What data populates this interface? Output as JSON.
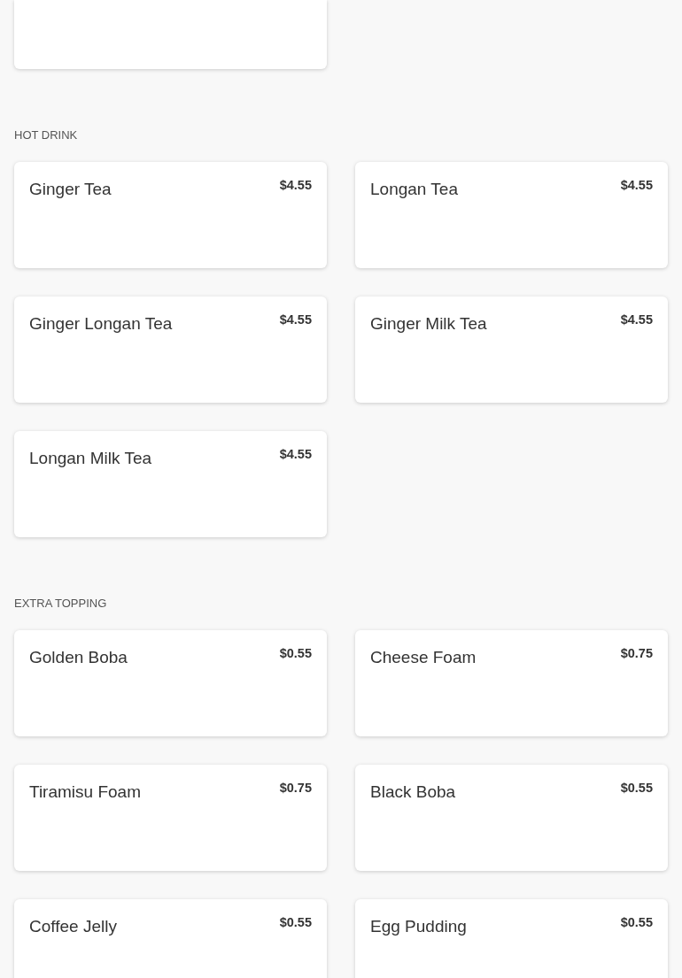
{
  "sections": [
    {
      "title": "HOT DRINK",
      "items": [
        {
          "name": "Ginger Tea",
          "price": "$4.55"
        },
        {
          "name": "Longan Tea",
          "price": "$4.55"
        },
        {
          "name": "Ginger Longan Tea",
          "price": "$4.55"
        },
        {
          "name": "Ginger Milk Tea",
          "price": "$4.55"
        },
        {
          "name": "Longan Milk Tea",
          "price": "$4.55"
        }
      ]
    },
    {
      "title": "EXTRA TOPPING",
      "items": [
        {
          "name": "Golden Boba",
          "price": "$0.55"
        },
        {
          "name": "Cheese Foam",
          "price": "$0.75"
        },
        {
          "name": "Tiramisu Foam",
          "price": "$0.75"
        },
        {
          "name": "Black Boba",
          "price": "$0.55"
        },
        {
          "name": "Coffee Jelly",
          "price": "$0.55"
        },
        {
          "name": "Egg Pudding",
          "price": "$0.55"
        }
      ]
    }
  ]
}
